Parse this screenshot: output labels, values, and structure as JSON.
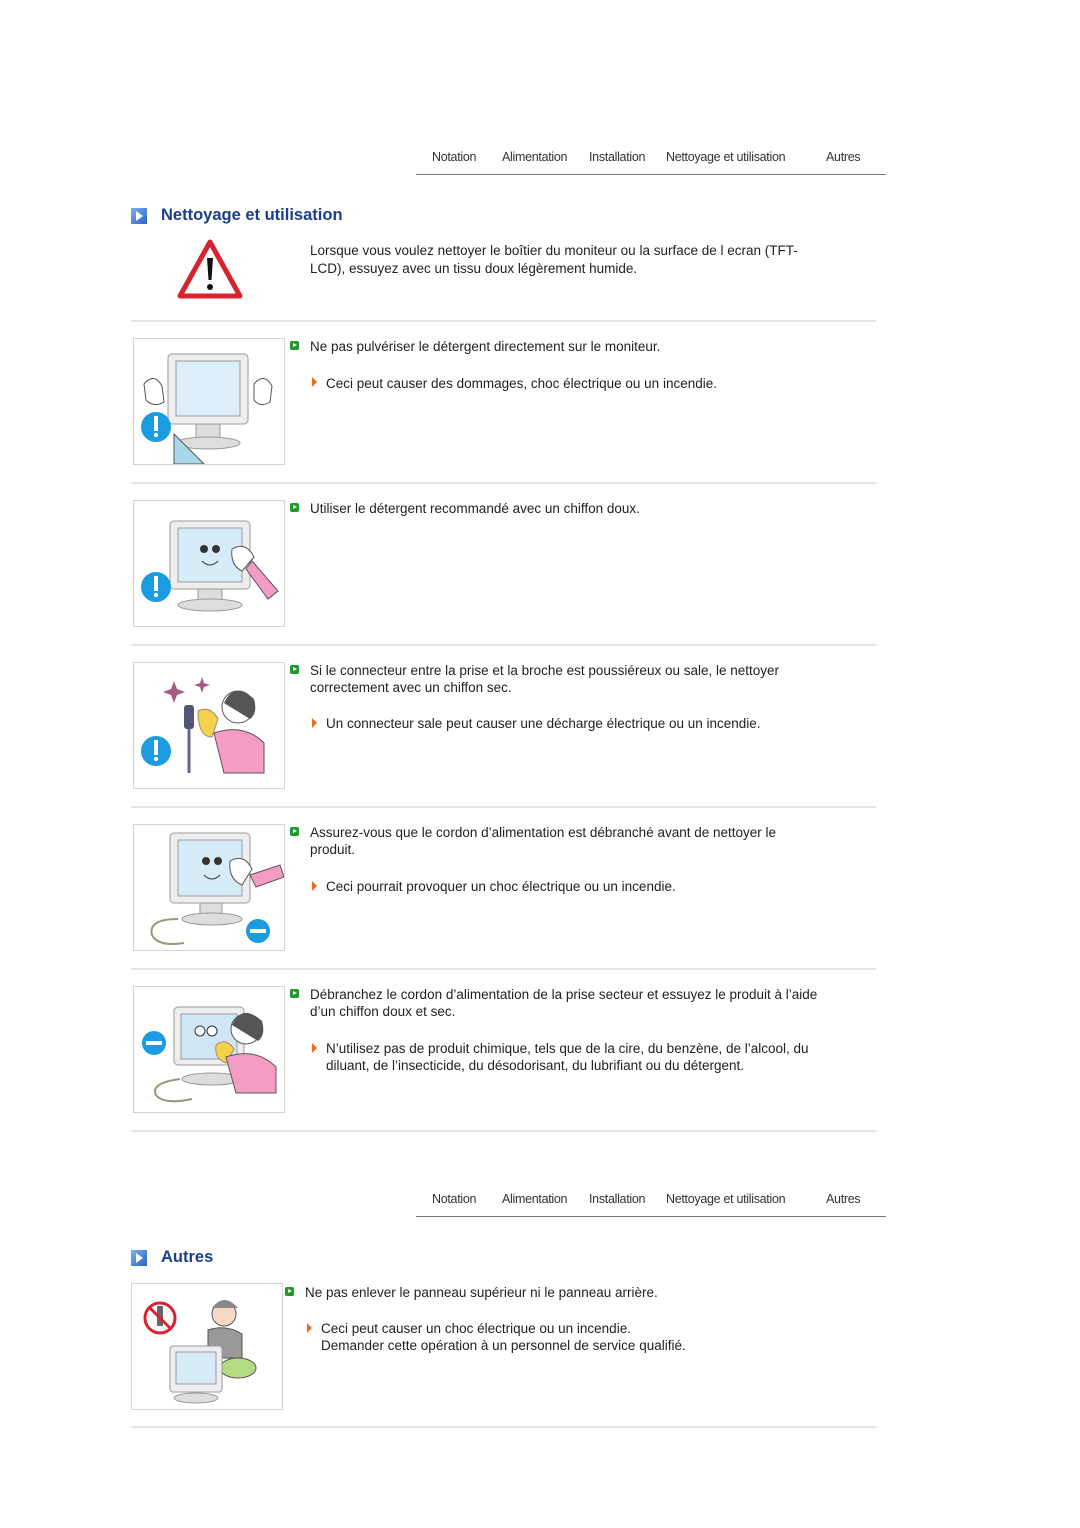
{
  "nav": {
    "items": [
      "Notation",
      "Alimentation",
      "Installation",
      "Nettoyage et utilisation",
      "Autres"
    ]
  },
  "section1": {
    "title": "Nettoyage et utilisation",
    "intro_line1": "Lorsque vous voulez nettoyer le boîtier du moniteur ou la surface de l ecran (TFT-",
    "intro_line2": "LCD), essuyez avec un tissu doux légèrement humide.",
    "items": [
      {
        "main": [
          "Ne pas pulvériser le détergent directement sur le moniteur."
        ],
        "sub": [
          "Ceci peut causer des dommages, choc électrique ou un incendie."
        ]
      },
      {
        "main": [
          "Utiliser le détergent recommandé avec un chiffon doux."
        ],
        "sub": []
      },
      {
        "main": [
          "Si le connecteur entre la prise et la broche est poussiéreux ou sale, le nettoyer",
          "correctement avec un chiffon sec."
        ],
        "sub": [
          "Un connecteur sale peut causer une décharge électrique ou un incendie."
        ]
      },
      {
        "main": [
          "Assurez-vous que le cordon d’alimentation est débranché avant de nettoyer le",
          "produit."
        ],
        "sub": [
          "Ceci pourrait provoquer un choc électrique ou un incendie."
        ]
      },
      {
        "main": [
          "Débranchez le cordon d’alimentation de la prise secteur et essuyez le produit à l’aide",
          "d’un chiffon doux et sec."
        ],
        "sub": [
          "N’utilisez pas de produit chimique, tels que de la cire, du benzène, de l’alcool, du",
          "diluant, de l’insecticide, du désodorisant, du lubrifiant ou du détergent."
        ]
      }
    ]
  },
  "section2": {
    "title": "Autres",
    "items": [
      {
        "main": [
          "Ne pas enlever le panneau supérieur ni le panneau arrière."
        ],
        "sub": [
          "Ceci peut causer un choc électrique ou un incendie.",
          "Demander cette opération à un personnel de service qualifié."
        ]
      }
    ]
  },
  "icons": {
    "section": "play-square-icon",
    "bullet": "green-bullet-icon",
    "sub_bullet": "orange-arrow-icon",
    "warning": "warning-triangle-icon"
  },
  "colors": {
    "title": "#1a3f8a",
    "bullet": "#1f9a2a",
    "arrow": "#f06a1e",
    "warning": "#d8232f"
  }
}
